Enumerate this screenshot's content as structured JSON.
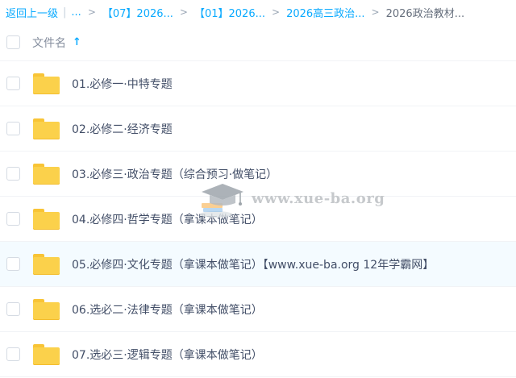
{
  "breadcrumb": {
    "back": "返回上一级",
    "sep": "|",
    "ellipsis": "...",
    "gt": ">",
    "items": [
      "【07】2026...",
      "【01】2026...",
      "2026高三政治..."
    ],
    "current": "2026政治教材..."
  },
  "header": {
    "column_name": "文件名",
    "sort_icon": "arrow-up-icon"
  },
  "files": [
    {
      "name": "01.必修一·中特专题"
    },
    {
      "name": "02.必修二·经济专题"
    },
    {
      "name": "03.必修三·政治专题（综合预习·做笔记）"
    },
    {
      "name": "04.必修四·哲学专题（拿课本做笔记）"
    },
    {
      "name": "05.必修四·文化专题（拿课本做笔记）【www.xue-ba.org 12年学霸网】"
    },
    {
      "name": "06.选必二·法律专题（拿课本做笔记）"
    },
    {
      "name": "07.选必三·逻辑专题（拿课本做笔记）"
    }
  ],
  "watermark": {
    "text": "www.xue-ba.org"
  },
  "colors": {
    "link": "#09aaff",
    "folder": "#fbd14b",
    "hover_row": "#f4fbff"
  }
}
